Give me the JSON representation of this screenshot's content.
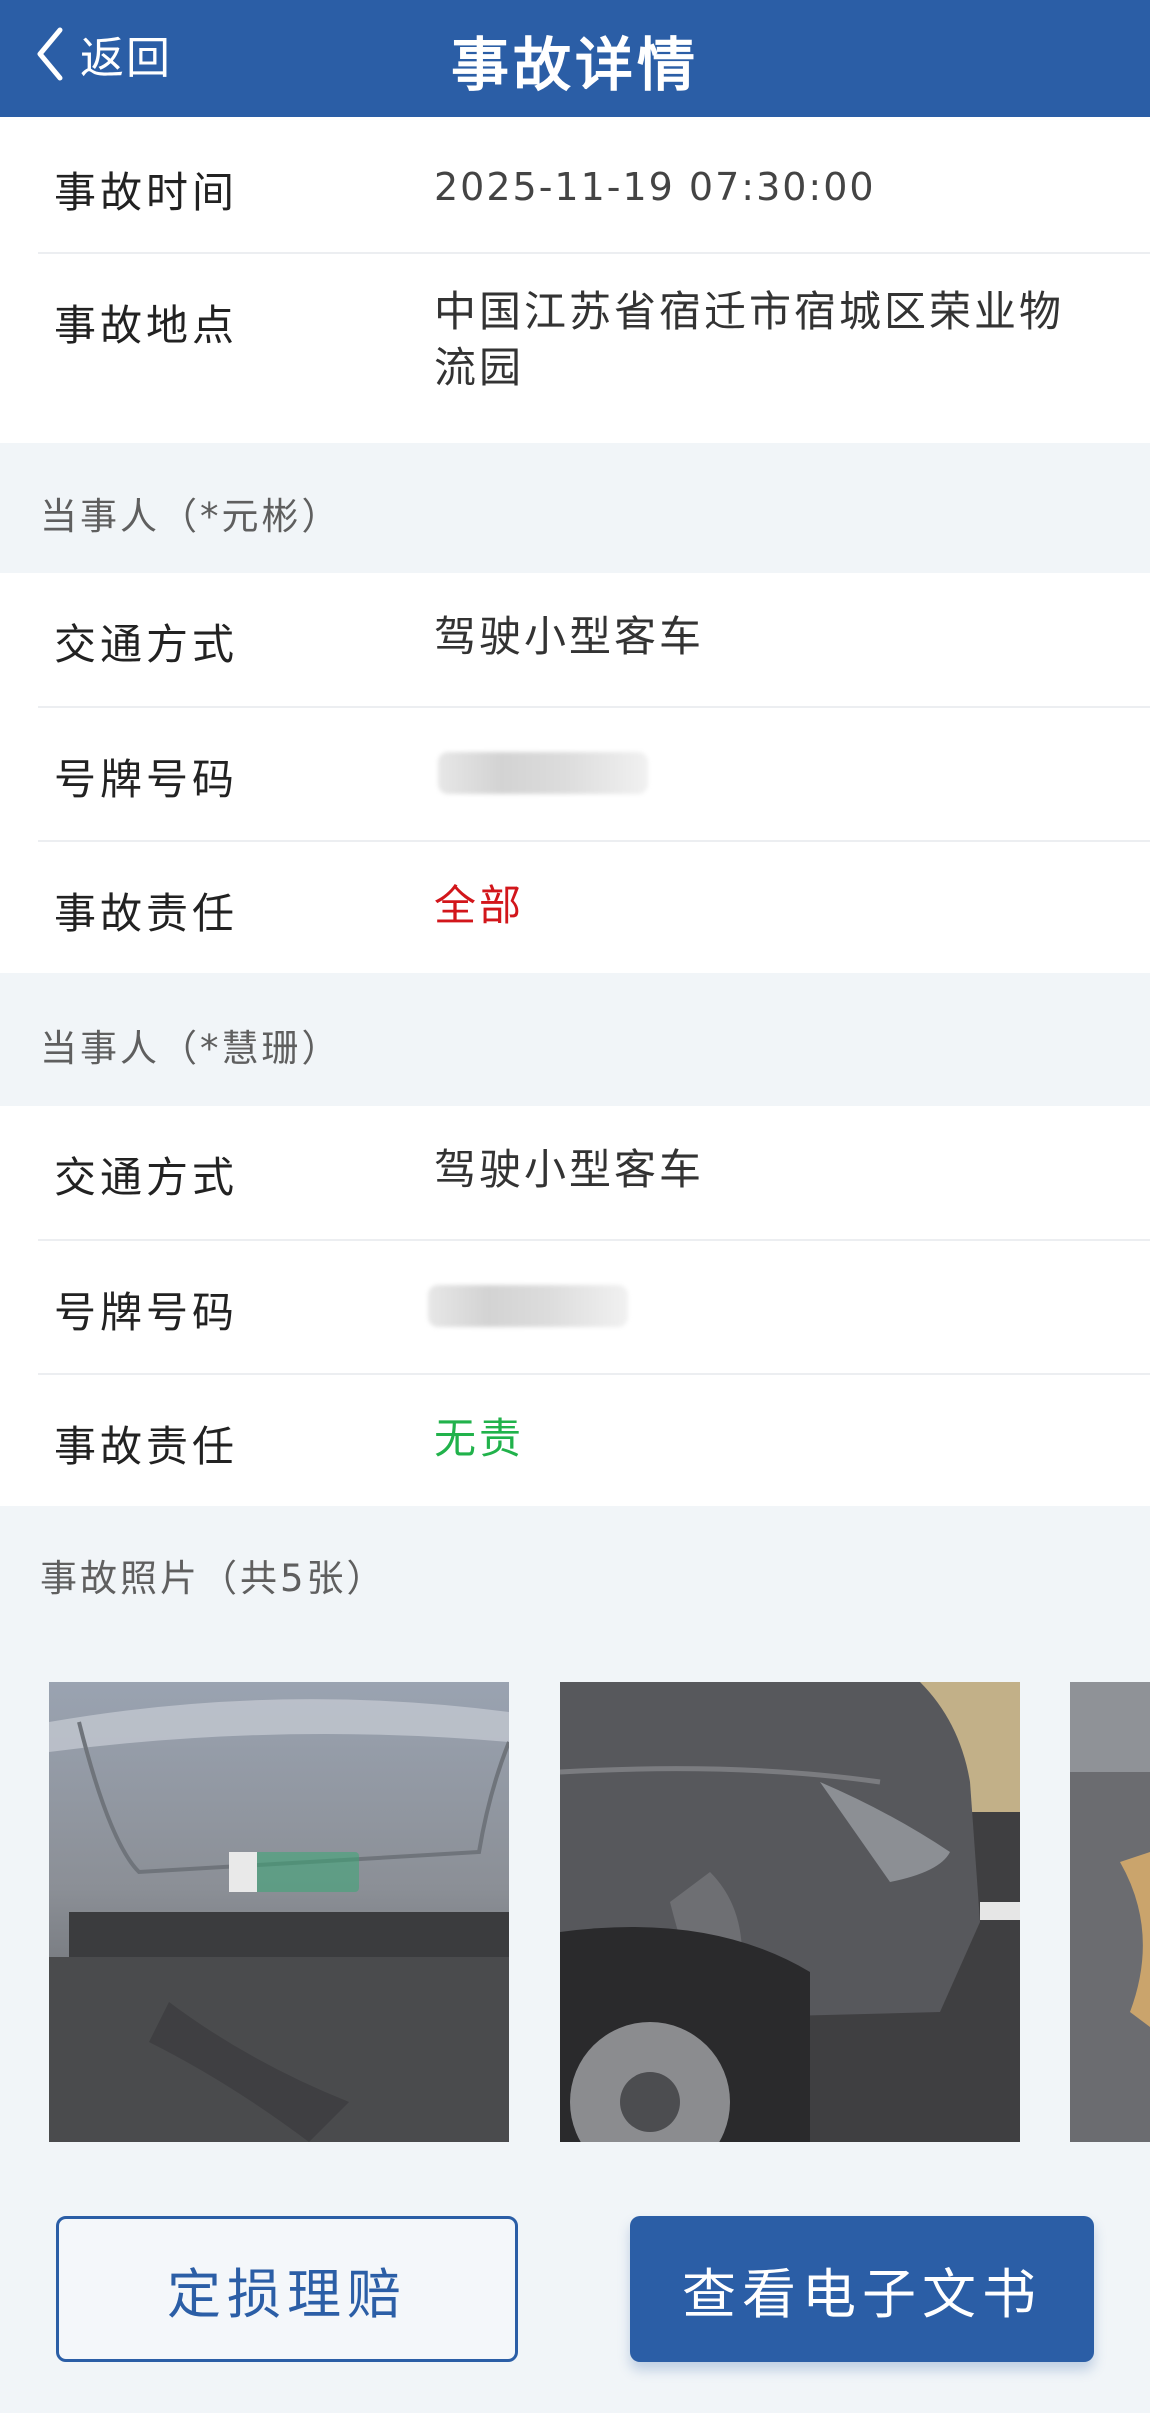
{
  "header": {
    "back_label": "返回",
    "title": "事故详情",
    "background_color": "#2b5ea6"
  },
  "accident": {
    "time_label": "事故时间",
    "time_value": "2025-11-19 07:30:00",
    "place_label": "事故地点",
    "place_value": "中国江苏省宿迁市宿城区荣业物流园"
  },
  "parties": [
    {
      "header": "当事人（*元彬）",
      "transport_label": "交通方式",
      "transport_value": "驾驶小型客车",
      "plate_label": "号牌号码",
      "responsibility_label": "事故责任",
      "responsibility_value": "全部",
      "responsibility_color": "#d2161b"
    },
    {
      "header": "当事人（*慧珊）",
      "transport_label": "交通方式",
      "transport_value": "驾驶小型客车",
      "plate_label": "号牌号码",
      "responsibility_label": "事故责任",
      "responsibility_value": "无责",
      "responsibility_color": "#21b24b"
    }
  ],
  "photos": {
    "header": "事故照片（共5张）"
  },
  "buttons": {
    "assess_label": "定损理赔",
    "view_document_label": "查看电子文书"
  }
}
